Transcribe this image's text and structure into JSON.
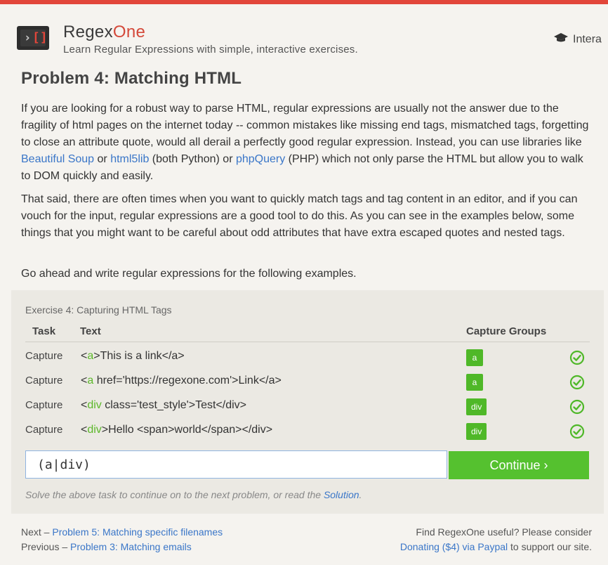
{
  "brand": {
    "name_prefix": "Regex",
    "name_suffix": "One",
    "tagline": "Learn Regular Expressions with simple, interactive exercises."
  },
  "nav": {
    "interactive_label": "Intera"
  },
  "problem": {
    "title": "Problem 4: Matching HTML",
    "p1_a": "If you are looking for a robust way to parse HTML, regular expressions are usually not the answer due to the fragility of html pages on the internet today -- common mistakes like missing end tags, mismatched tags, forgetting to close an attribute quote, would all derail a perfectly good regular expression. Instead, you can use libraries like ",
    "link_beautiful_soup": "Beautiful Soup",
    "p1_b": " or ",
    "link_html5lib": "html5lib",
    "p1_c": " (both Python) or ",
    "link_phpquery": "phpQuery",
    "p1_d": " (PHP) which not only parse the HTML but allow you to walk to DOM quickly and easily.",
    "p2": "That said, there are often times when you want to quickly match tags and tag content in an editor, and if you can vouch for the input, regular expressions are a good tool to do this. As you can see in the examples below, some things that you might want to be careful about odd attributes that have extra escaped quotes and nested tags.",
    "p3": "Go ahead and write regular expressions for the following examples."
  },
  "exercise": {
    "title": "Exercise 4: Capturing HTML Tags",
    "headers": {
      "task": "Task",
      "text": "Text",
      "capture_groups": "Capture Groups"
    },
    "rows": [
      {
        "task": "Capture",
        "pre": "<",
        "hl": "a",
        "post": ">This is a link</a>",
        "group": "a"
      },
      {
        "task": "Capture",
        "pre": "<",
        "hl": "a",
        "post": " href='https://regexone.com'>Link</a>",
        "group": "a"
      },
      {
        "task": "Capture",
        "pre": "<",
        "hl": "div",
        "post": " class='test_style'>Test</div>",
        "group": "div"
      },
      {
        "task": "Capture",
        "pre": "<",
        "hl": "div",
        "post": ">Hello <span>world</span></div>",
        "group": "div"
      }
    ],
    "input_value": "(a|div)",
    "continue_label": "Continue ›",
    "note_prefix": "Solve the above task to continue on to the next problem, or read the ",
    "note_link": "Solution",
    "note_suffix": ".",
    "colors": {
      "accent_green": "#55c12f",
      "badge_green": "#4fb828",
      "highlight_green": "#5cb82a",
      "link_blue": "#3a76c8",
      "brand_red": "#e2463a"
    }
  },
  "footer": {
    "next_prefix": "Next – ",
    "next_link": "Problem 5: Matching specific filenames",
    "prev_prefix": "Previous – ",
    "prev_link": "Problem 3: Matching emails",
    "support_line1": "Find RegexOne useful? Please consider",
    "donate_link": "Donating ($4) via Paypal",
    "support_line2_suffix": " to support our site."
  }
}
